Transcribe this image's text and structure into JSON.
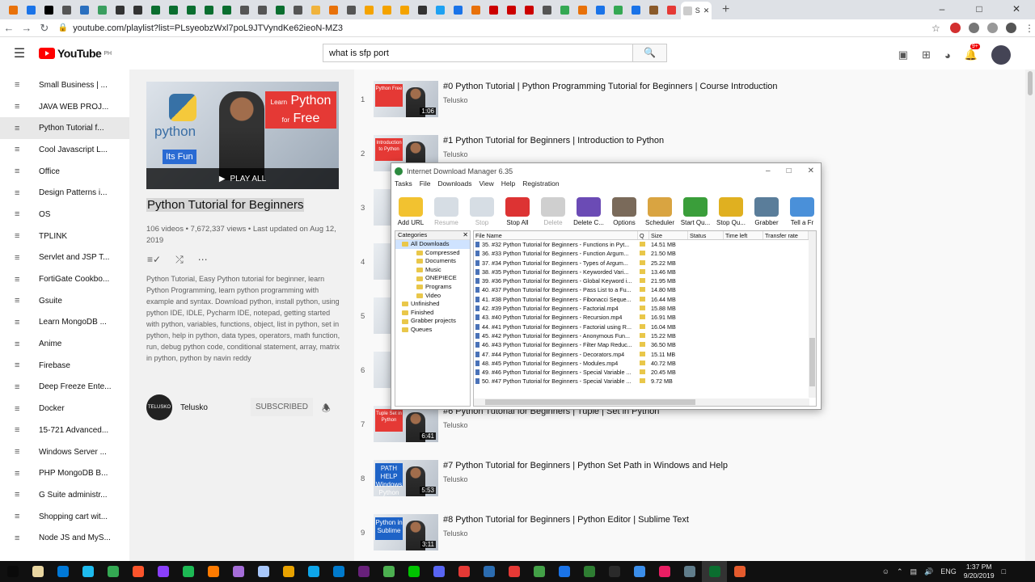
{
  "browser": {
    "tab_labels": [
      "K",
      "W",
      "F",
      "C",
      "V",
      "M",
      "C",
      "N",
      "M",
      "N",
      "I",
      "T",
      "N",
      "C",
      "I",
      "M",
      "V",
      "V",
      "V",
      "C",
      "D",
      "N",
      "A",
      "R",
      "(",
      "S",
      "R",
      "M",
      "M",
      "(",
      "I",
      "G",
      "I",
      "T",
      "G",
      "S",
      "K",
      "G"
    ],
    "tab_colors": [
      "#e8710a",
      "#1a73e8",
      "#000000",
      "#555555",
      "#2a6fbf",
      "#3a9e5f",
      "#333333",
      "#333333",
      "#0a6e2f",
      "#0a6e2f",
      "#0a6e2f",
      "#0a6e2f",
      "#0a6e2f",
      "#555555",
      "#555555",
      "#0a6e2f",
      "#555555",
      "#f0b33c",
      "#e8710a",
      "#555555",
      "#f4a300",
      "#f4a300",
      "#f4a300",
      "#333333",
      "#1da1f2",
      "#1a73e8",
      "#e8710a",
      "#cc0000",
      "#cc0000",
      "#cc0000",
      "#555555",
      "#34a853",
      "#e8710a",
      "#1a73e8",
      "#34a853",
      "#1a73e8",
      "#8a5a2a",
      "#e53935"
    ],
    "active_tab_label": "S",
    "url": "youtube.com/playlist?list=PLsyeobzWxl7poL9JTVyndKe62ieoN-MZ3"
  },
  "youtube": {
    "brand": "YouTube",
    "region": "PH",
    "search_value": "what is sfp port",
    "notification_count": "9+"
  },
  "sidebar": {
    "items": [
      "Small Business | ...",
      "JAVA WEB PROJ...",
      "Python Tutorial f...",
      "Cool Javascript L...",
      "Office",
      "Design Patterns i...",
      "OS",
      "TPLINK",
      "Servlet and JSP T...",
      "FortiGate Cookbo...",
      "Gsuite",
      "Learn MongoDB ...",
      "Anime",
      "Firebase",
      "Deep Freeze Ente...",
      "Docker",
      "15-721 Advanced...",
      "Windows Server ...",
      "PHP MongoDB B...",
      "G Suite administr...",
      "Shopping cart wit...",
      "Node JS and MyS..."
    ],
    "selected_index": 2
  },
  "playlist": {
    "thumb_python": "python",
    "thumb_learn": "Learn",
    "thumb_python_big": "Python",
    "thumb_for": "for",
    "thumb_free": "Free",
    "thumb_fun": "Its Fun",
    "play_all": "PLAY ALL",
    "title": "Python Tutorial for Beginners",
    "meta": "106 videos • 7,672,337 views • Last updated on Aug 12, 2019",
    "description": "Python Tutorial, Easy Python tutorial for beginner, learn Python Programming, learn python programming with example and syntax. Download python, install python, using python IDE, IDLE, Pycharm IDE, notepad, getting started with python, variables, functions, object, list in python, set in python, help in python, data types, operators, math function, run, debug python code, conditional statement, array, matrix in python, python by navin reddy",
    "owner_logo": "TELUSKO",
    "owner": "Telusko",
    "subscribed_label": "SUBSCRIBED"
  },
  "videos": [
    {
      "index": "1",
      "title": "#0 Python Tutorial | Python Programming Tutorial for Beginners | Course Introduction",
      "channel": "Telusko",
      "duration": "1:06",
      "tag": "Python Free"
    },
    {
      "index": "2",
      "title": "#1 Python Tutorial for Beginners | Introduction to Python",
      "channel": "Telusko",
      "duration": "",
      "tag": "Introduction to Python"
    },
    {
      "index": "3",
      "title": "",
      "channel": "",
      "duration": "",
      "tag": ""
    },
    {
      "index": "4",
      "title": "",
      "channel": "",
      "duration": "",
      "tag": ""
    },
    {
      "index": "5",
      "title": "",
      "channel": "",
      "duration": "",
      "tag": ""
    },
    {
      "index": "6",
      "title": "",
      "channel": "",
      "duration": "",
      "tag": ""
    },
    {
      "index": "7",
      "title": "#6 Python Tutorial for Beginners | Tuple | Set in Python",
      "channel": "Telusko",
      "duration": "6:41",
      "tag": "Tuple Set in Python"
    },
    {
      "index": "8",
      "title": "#7 Python Tutorial for Beginners | Python Set Path in Windows and Help",
      "channel": "Telusko",
      "duration": "5:53",
      "tag": "PATH HELP Windows Python"
    },
    {
      "index": "9",
      "title": "#8 Python Tutorial for Beginners | Python Editor | Sublime Text",
      "channel": "Telusko",
      "duration": "3:11",
      "tag": "Python in Sublime"
    }
  ],
  "idm": {
    "title": "Internet Download Manager 6.35",
    "menu": [
      "Tasks",
      "File",
      "Downloads",
      "View",
      "Help",
      "Registration"
    ],
    "toolbar": [
      {
        "label": "Add URL",
        "enabled": true,
        "color": "#f2c230"
      },
      {
        "label": "Resume",
        "enabled": false,
        "color": "#9ab"
      },
      {
        "label": "Stop",
        "enabled": false,
        "color": "#9ab"
      },
      {
        "label": "Stop All",
        "enabled": true,
        "color": "#d33"
      },
      {
        "label": "Delete",
        "enabled": false,
        "color": "#888"
      },
      {
        "label": "Delete C...",
        "enabled": true,
        "color": "#6b4bb5"
      },
      {
        "label": "Options",
        "enabled": true,
        "color": "#7a6a5a"
      },
      {
        "label": "Scheduler",
        "enabled": true,
        "color": "#d9a441"
      },
      {
        "label": "Start Qu...",
        "enabled": true,
        "color": "#3a9e3a"
      },
      {
        "label": "Stop Qu...",
        "enabled": true,
        "color": "#e0b020"
      },
      {
        "label": "Grabber",
        "enabled": true,
        "color": "#5a7d9a"
      },
      {
        "label": "Tell a Fr",
        "enabled": true,
        "color": "#4a90d9"
      }
    ],
    "categories_header": "Categories",
    "categories": [
      "All Downloads",
      "Compressed",
      "Documents",
      "Music",
      "ONEPIECE",
      "Programs",
      "Video",
      "Unfinished",
      "Finished",
      "Grabber projects",
      "Queues"
    ],
    "columns": [
      "File Name",
      "Q",
      "Size",
      "Status",
      "Time left",
      "Transfer rate"
    ],
    "files": [
      {
        "name": "35. #32 Python Tutorial for Beginners - Functions in Pyt...",
        "size": "14.51 MB"
      },
      {
        "name": "36. #33 Python Tutorial for Beginners - Function Argum...",
        "size": "21.50 MB"
      },
      {
        "name": "37. #34 Python Tutorial for Beginners - Types of Argum...",
        "size": "25.22 MB"
      },
      {
        "name": "38. #35 Python Tutorial for Beginners - Keyworded Vari...",
        "size": "13.46 MB"
      },
      {
        "name": "39. #36 Python Tutorial for Beginners - Global Keyword i...",
        "size": "21.95 MB"
      },
      {
        "name": "40. #37 Python Tutorial for Beginners - Pass List to a Fu...",
        "size": "14.80 MB"
      },
      {
        "name": "41. #38 Python Tutorial for Beginners - Fibonacci Seque...",
        "size": "16.44 MB"
      },
      {
        "name": "42. #39 Python Tutorial for Beginners - Factorial.mp4",
        "size": "15.88 MB"
      },
      {
        "name": "43. #40 Python Tutorial for Beginners - Recursion.mp4",
        "size": "16.91 MB"
      },
      {
        "name": "44. #41 Python Tutorial for Beginners - Factorial using R...",
        "size": "16.04 MB"
      },
      {
        "name": "45. #42 Python Tutorial for Beginners - Anonymous Fun...",
        "size": "15.22 MB"
      },
      {
        "name": "46. #43 Python Tutorial for Beginners - Filter Map Reduc...",
        "size": "36.50 MB"
      },
      {
        "name": "47. #44 Python Tutorial for Beginners - Decorators.mp4",
        "size": "15.11 MB"
      },
      {
        "name": "48. #45 Python Tutorial for Beginners - Modules.mp4",
        "size": "40.72 MB"
      },
      {
        "name": "49. #46 Python Tutorial for Beginners - Special Variable ...",
        "size": "20.45 MB"
      },
      {
        "name": "50. #47 Python Tutorial for Beginners - Special Variable ...",
        "size": "9.72 MB"
      }
    ]
  },
  "taskbar": {
    "apps": [
      "#0a0a0a",
      "#e8d5a0",
      "#0078d7",
      "#1ebbee",
      "#34a853",
      "#fb542b",
      "#8a3ffc",
      "#1db954",
      "#ff7b00",
      "#a56dd8",
      "#a8c7fa",
      "#e8a200",
      "#0ea5e9",
      "#007acc",
      "#68217a",
      "#4caf50",
      "#00c300",
      "#5865f2",
      "#e53935",
      "#2b6cb0",
      "#e53935",
      "#43a047",
      "#1a73e8",
      "#2e7d32",
      "#2a2a2a",
      "#3b8eea",
      "#e91e63",
      "#607d8b",
      "#0a6e2f",
      "#e55b2d"
    ],
    "active_index": 28,
    "time": "1:37 PM",
    "date": "9/20/2019"
  }
}
